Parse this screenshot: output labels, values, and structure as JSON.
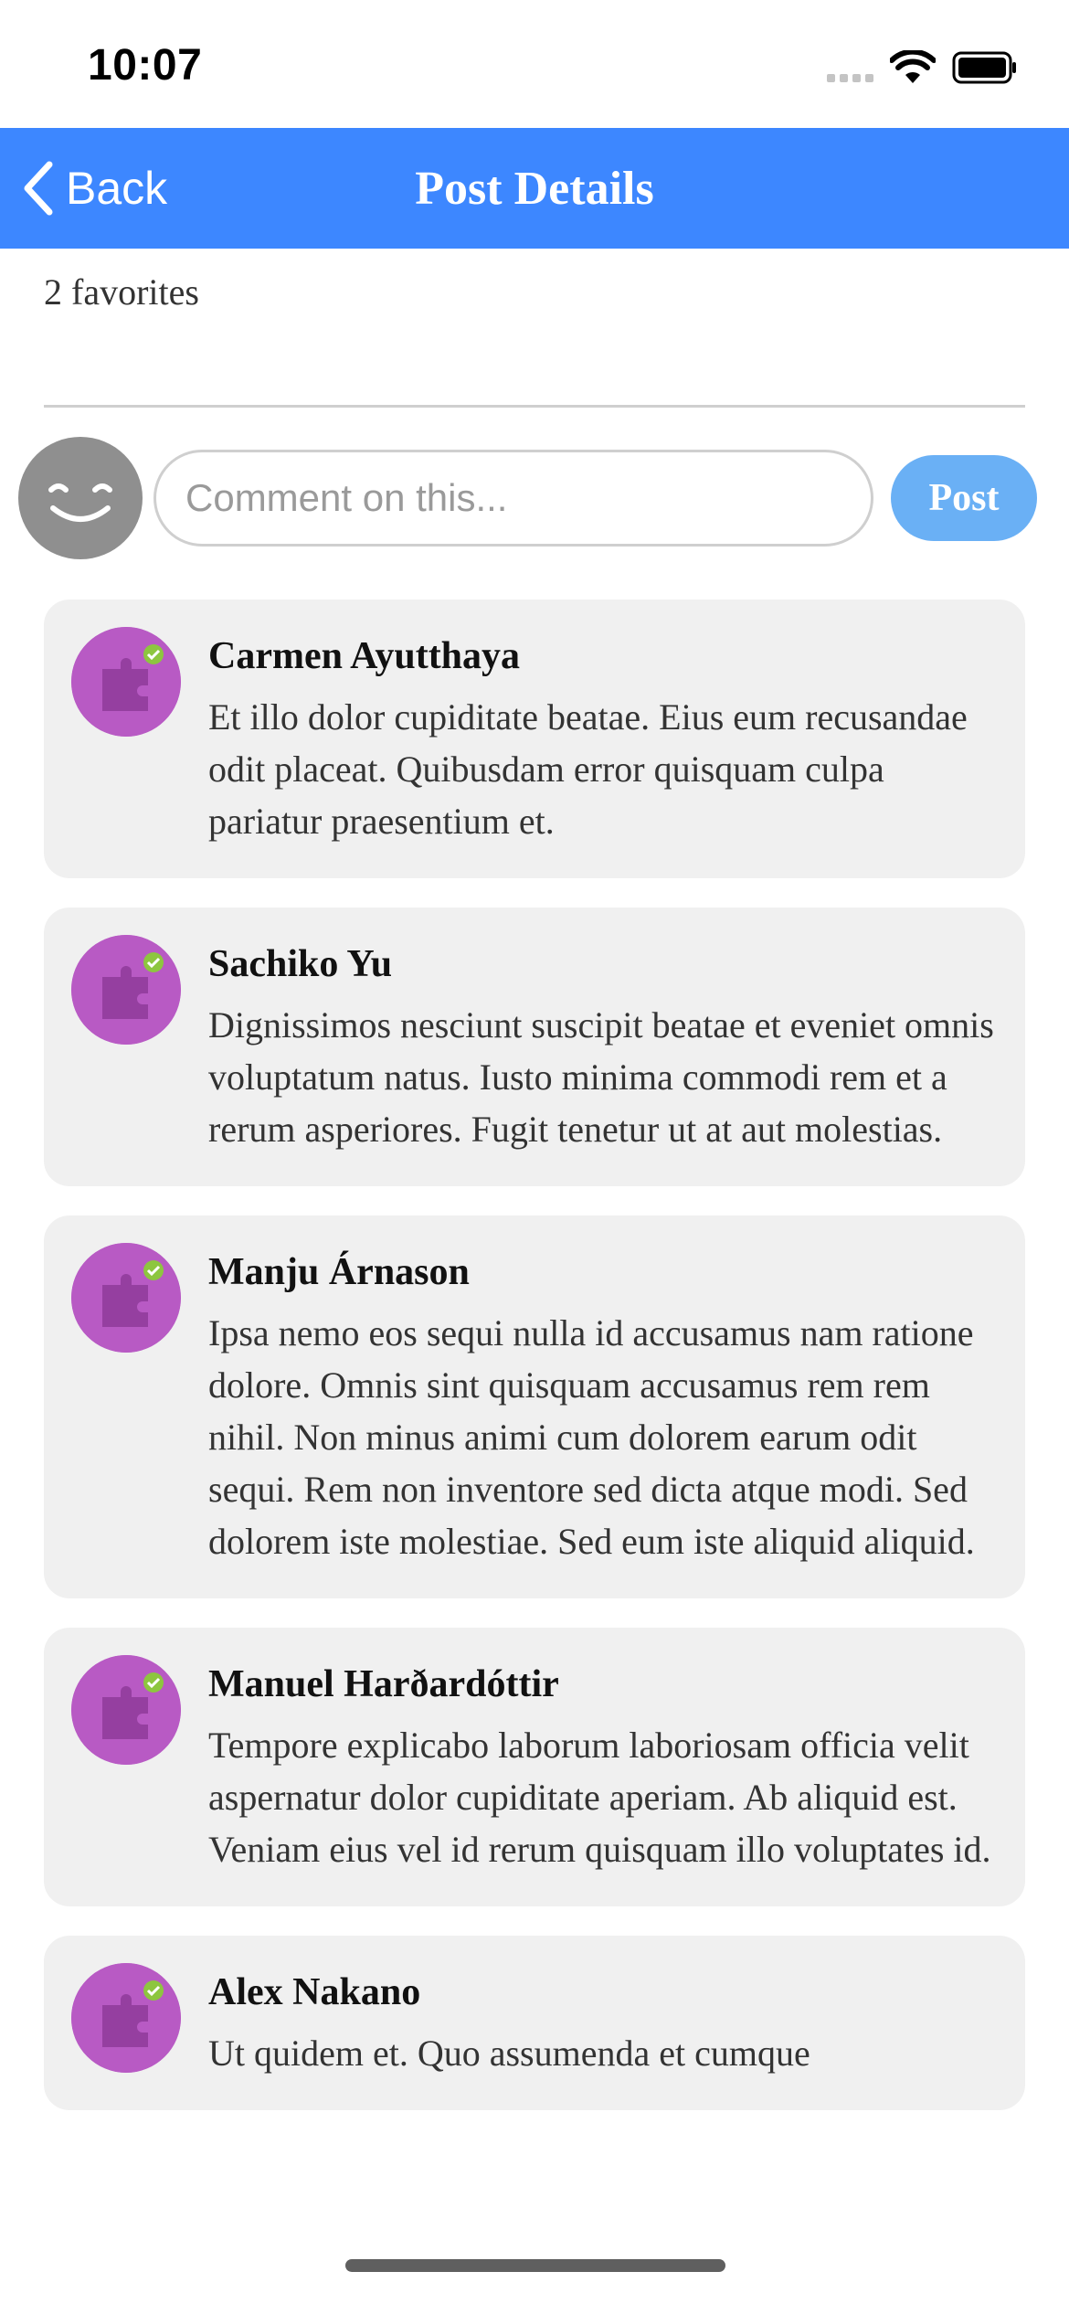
{
  "status_bar": {
    "time": "10:07"
  },
  "nav": {
    "back_label": "Back",
    "title": "Post Details",
    "background_color": "#3d87ff"
  },
  "post": {
    "favorites": "2 favorites"
  },
  "comment_form": {
    "placeholder": "Comment on this...",
    "post_label": "Post"
  },
  "comments": [
    {
      "author": "Carmen Ayutthaya",
      "text": "Et illo dolor cupiditate beatae. Eius eum recusandae odit placeat. Quibusdam error quisquam culpa pariatur praesentium et."
    },
    {
      "author": "Sachiko Yu",
      "text": "Dignissimos nesciunt suscipit beatae et eveniet omnis voluptatum natus. Iusto minima commodi rem et a rerum asperiores. Fugit tenetur ut at aut molestias."
    },
    {
      "author": "Manju Árnason",
      "text": "Ipsa nemo eos sequi nulla id accusamus nam ratione dolore. Omnis sint quisquam accusamus rem rem nihil. Non minus animi cum dolorem earum odit sequi. Rem non inventore sed dicta atque modi. Sed dolorem iste molestiae. Sed eum iste aliquid aliquid."
    },
    {
      "author": "Manuel Harðardóttir",
      "text": "Tempore explicabo laborum laboriosam officia velit aspernatur dolor cupiditate aperiam. Ab aliquid est. Veniam eius vel id rerum quisquam illo voluptates id."
    },
    {
      "author": "Alex Nakano",
      "text": "Ut quidem et. Quo assumenda et cumque"
    }
  ]
}
